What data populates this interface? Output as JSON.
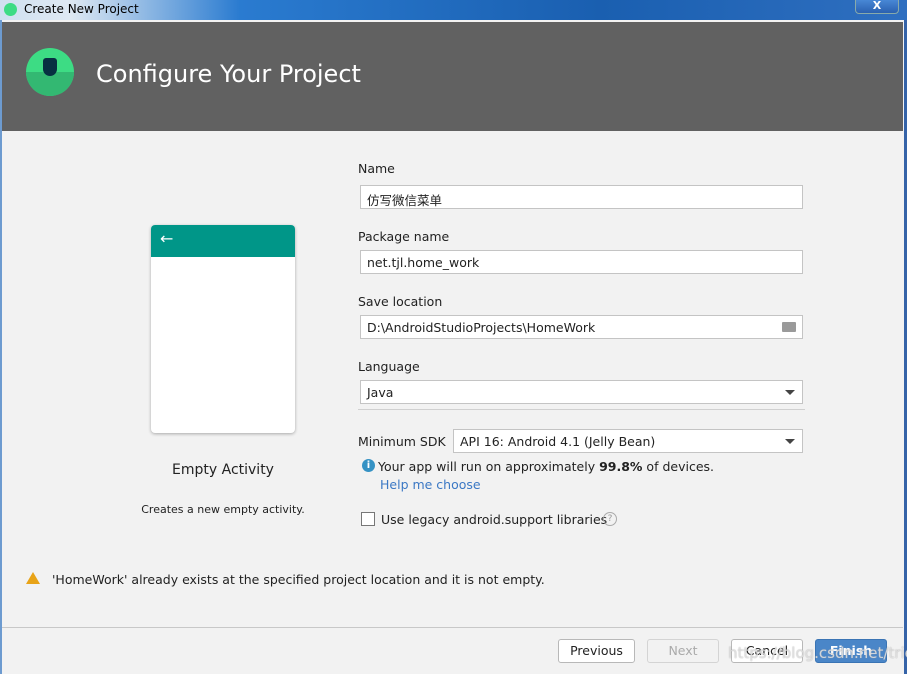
{
  "window": {
    "title": "Create New Project",
    "close": "X"
  },
  "header": {
    "title": "Configure Your Project"
  },
  "template": {
    "name": "Empty Activity",
    "description": "Creates a new empty activity.",
    "back_arrow": "←"
  },
  "form": {
    "name_label": "Name",
    "name_value": "仿写微信菜单",
    "package_label": "Package name",
    "package_value": "net.tjl.home_work",
    "save_label": "Save location",
    "save_value": "D:\\AndroidStudioProjects\\HomeWork",
    "language_label": "Language",
    "language_value": "Java",
    "minsdk_label": "Minimum SDK",
    "minsdk_value": "API 16: Android 4.1 (Jelly Bean)",
    "info_pre": "Your app will run on approximately ",
    "info_pct": "99.8%",
    "info_post": " of devices.",
    "help_link": "Help me choose",
    "legacy_label": "Use legacy android.support libraries",
    "legacy_checked": false
  },
  "warning": "'HomeWork' already exists at the specified project location and it is not empty.",
  "buttons": {
    "previous": "Previous",
    "next": "Next",
    "cancel": "Cancel",
    "finish": "Finish"
  },
  "watermark": "https://blog.csdn.net/triet"
}
